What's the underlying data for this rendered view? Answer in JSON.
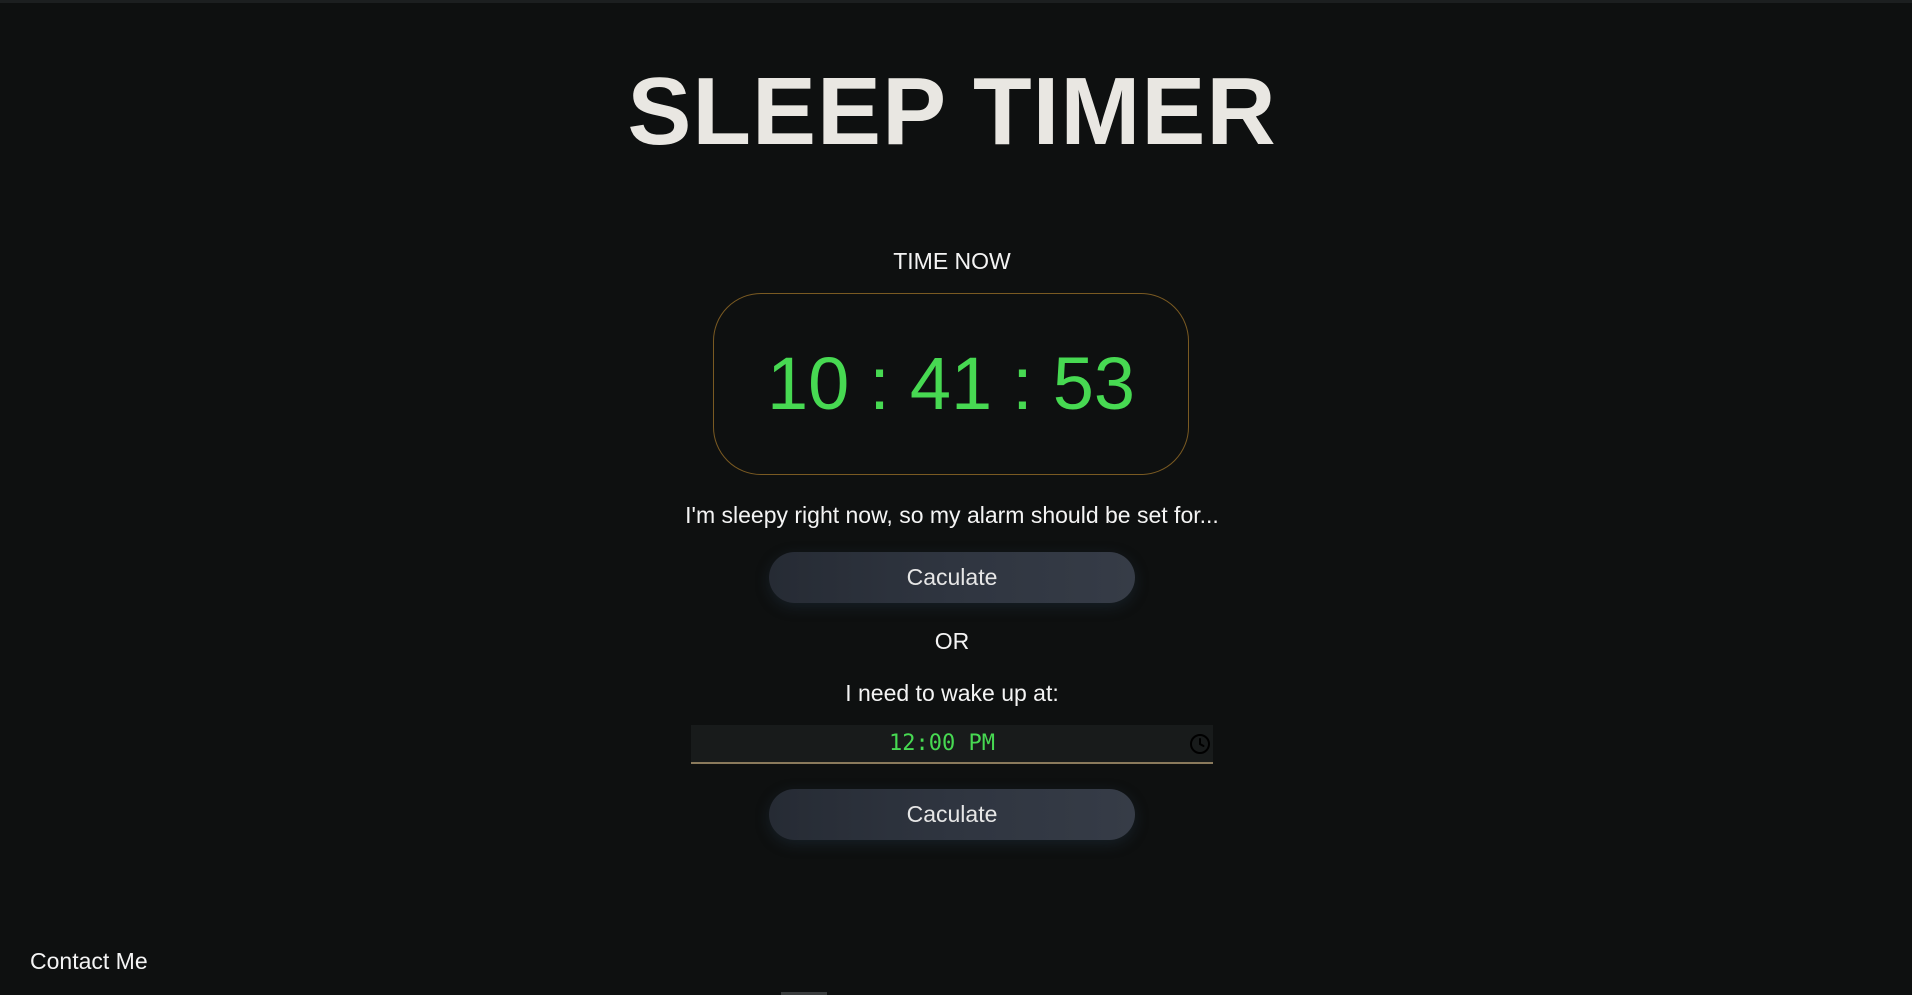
{
  "header": {
    "title": "SLEEP TIMER"
  },
  "clock": {
    "label": "TIME NOW",
    "hours": "10",
    "minutes": "41",
    "seconds": "53",
    "separator": ":"
  },
  "sleep_now": {
    "text": "I'm sleepy right now, so my alarm should be set for...",
    "button_label": "Caculate"
  },
  "divider": {
    "text": "OR"
  },
  "wake_up": {
    "text": "I need to wake up at:",
    "time_value": "12:00 PM",
    "button_label": "Caculate"
  },
  "footer": {
    "contact_label": "Contact Me"
  },
  "colors": {
    "background": "#0e1010",
    "digits": "#47d952",
    "clock_border": "#7a5a22",
    "button": "#2f3540"
  },
  "icons": {
    "time_picker": "clock-icon"
  }
}
